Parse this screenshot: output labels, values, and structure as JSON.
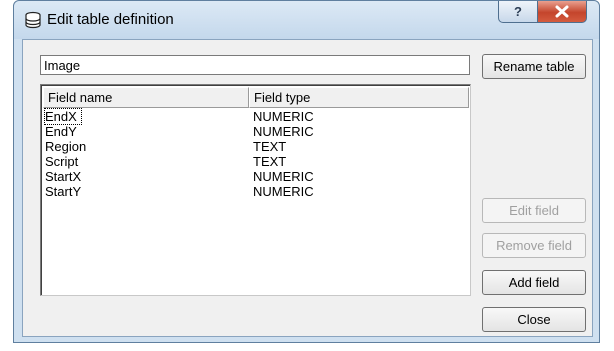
{
  "window": {
    "title": "Edit table definition",
    "icon": "database-icon",
    "controls": {
      "help": "?",
      "close": "X"
    }
  },
  "table_name": {
    "value": "Image"
  },
  "buttons": {
    "rename": "Rename table",
    "edit": "Edit field",
    "remove": "Remove field",
    "add": "Add field",
    "close": "Close"
  },
  "fields_list": {
    "columns": [
      "Field name",
      "Field type"
    ],
    "rows": [
      {
        "name": "EndX",
        "type": "NUMERIC"
      },
      {
        "name": "EndY",
        "type": "NUMERIC"
      },
      {
        "name": "Region",
        "type": "TEXT"
      },
      {
        "name": "Script",
        "type": "TEXT"
      },
      {
        "name": "StartX",
        "type": "NUMERIC"
      },
      {
        "name": "StartY",
        "type": "NUMERIC"
      }
    ]
  }
}
